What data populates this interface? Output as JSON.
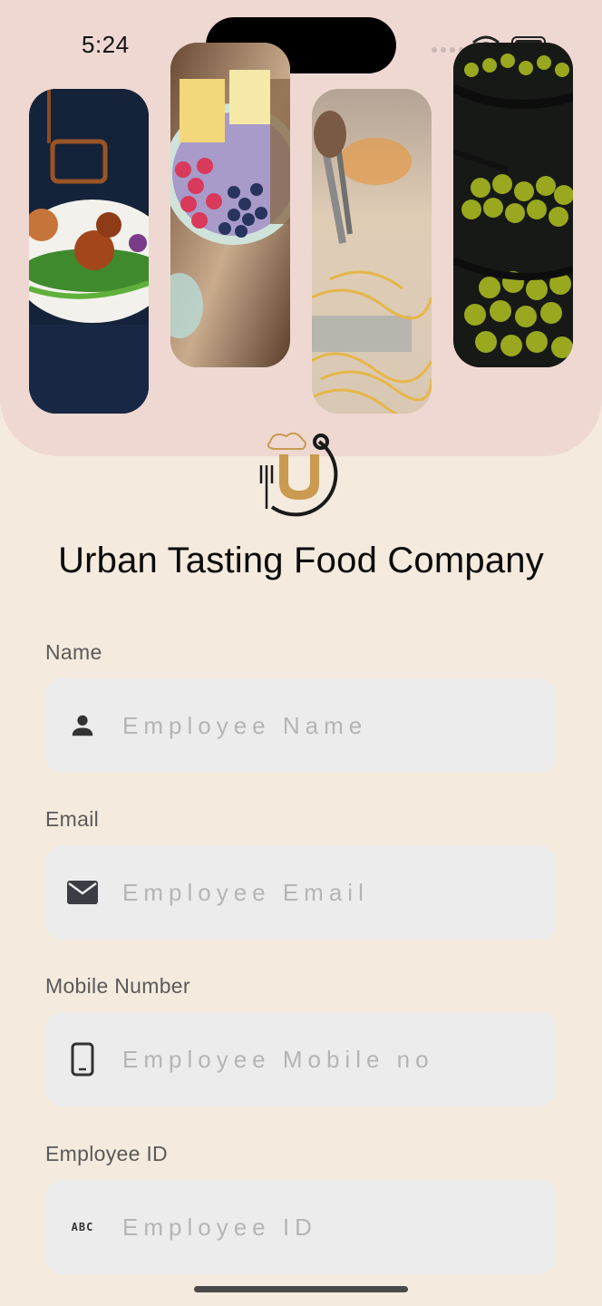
{
  "status_bar": {
    "time": "5:24"
  },
  "hero": {
    "photos": [
      {
        "name": "plated-dish-photo"
      },
      {
        "name": "smoothie-bowl-photo"
      },
      {
        "name": "noodles-cooking-photo"
      },
      {
        "name": "olives-photo"
      }
    ]
  },
  "brand": {
    "title": "Urban Tasting Food Company",
    "logo_letter": "U"
  },
  "form": {
    "name": {
      "label": "Name",
      "placeholder": "Employee Name",
      "value": ""
    },
    "email": {
      "label": "Email",
      "placeholder": "Employee Email",
      "value": ""
    },
    "mobile": {
      "label": "Mobile Number",
      "placeholder": "Employee Mobile no",
      "value": ""
    },
    "employee_id": {
      "label": "Employee ID",
      "placeholder": "Employee ID",
      "value": "",
      "icon_text": "ABC"
    }
  },
  "colors": {
    "background": "#f4eadd",
    "hero": "#eed8d1",
    "field": "#ececec",
    "accent_gold": "#c99a4f"
  }
}
